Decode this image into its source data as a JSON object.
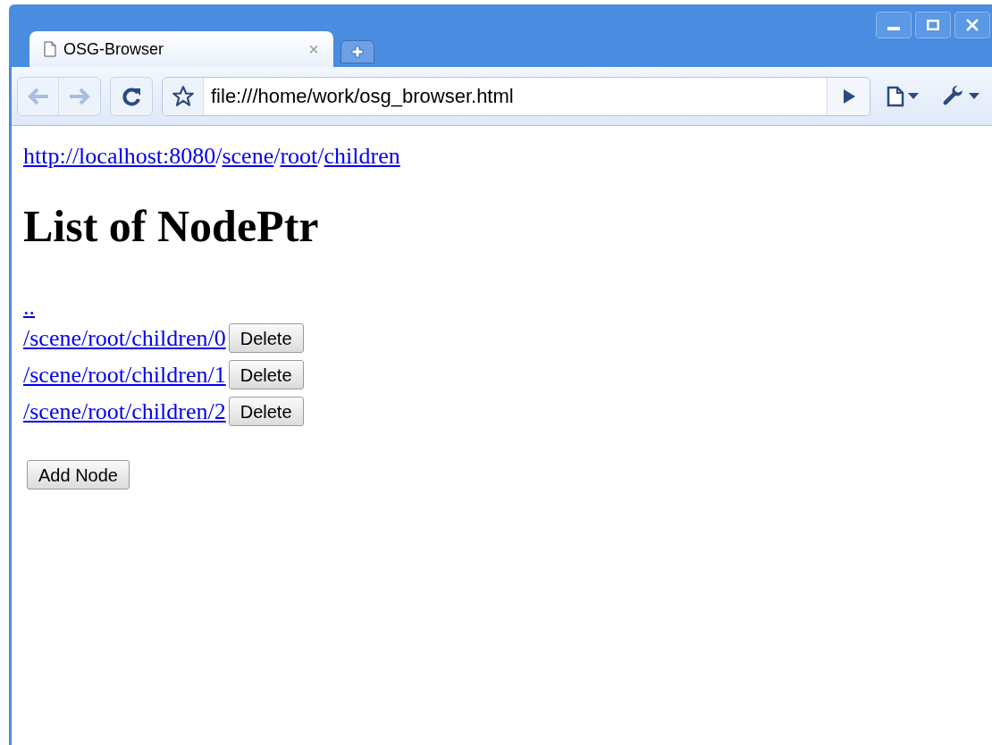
{
  "tabs": [
    {
      "title": "OSG-Browser",
      "close": "×",
      "selected": true
    }
  ],
  "address_bar": {
    "value": "file:///home/work/osg_browser.html"
  },
  "page": {
    "breadcrumb": [
      {
        "kind": "link",
        "text": "http://localhost:8080"
      },
      {
        "kind": "separator",
        "text": "/"
      },
      {
        "kind": "link",
        "text": "scene"
      },
      {
        "kind": "separator",
        "text": "/"
      },
      {
        "kind": "link",
        "text": "root"
      },
      {
        "kind": "separator",
        "text": "/"
      },
      {
        "kind": "link",
        "text": "children"
      }
    ],
    "heading": "List of NodePtr",
    "parent_link": "..",
    "items": [
      {
        "link": "/scene/root/children/0",
        "button": "Delete"
      },
      {
        "link": "/scene/root/children/1",
        "button": "Delete"
      },
      {
        "link": "/scene/root/children/2",
        "button": "Delete"
      }
    ],
    "add_button": "Add Node"
  }
}
